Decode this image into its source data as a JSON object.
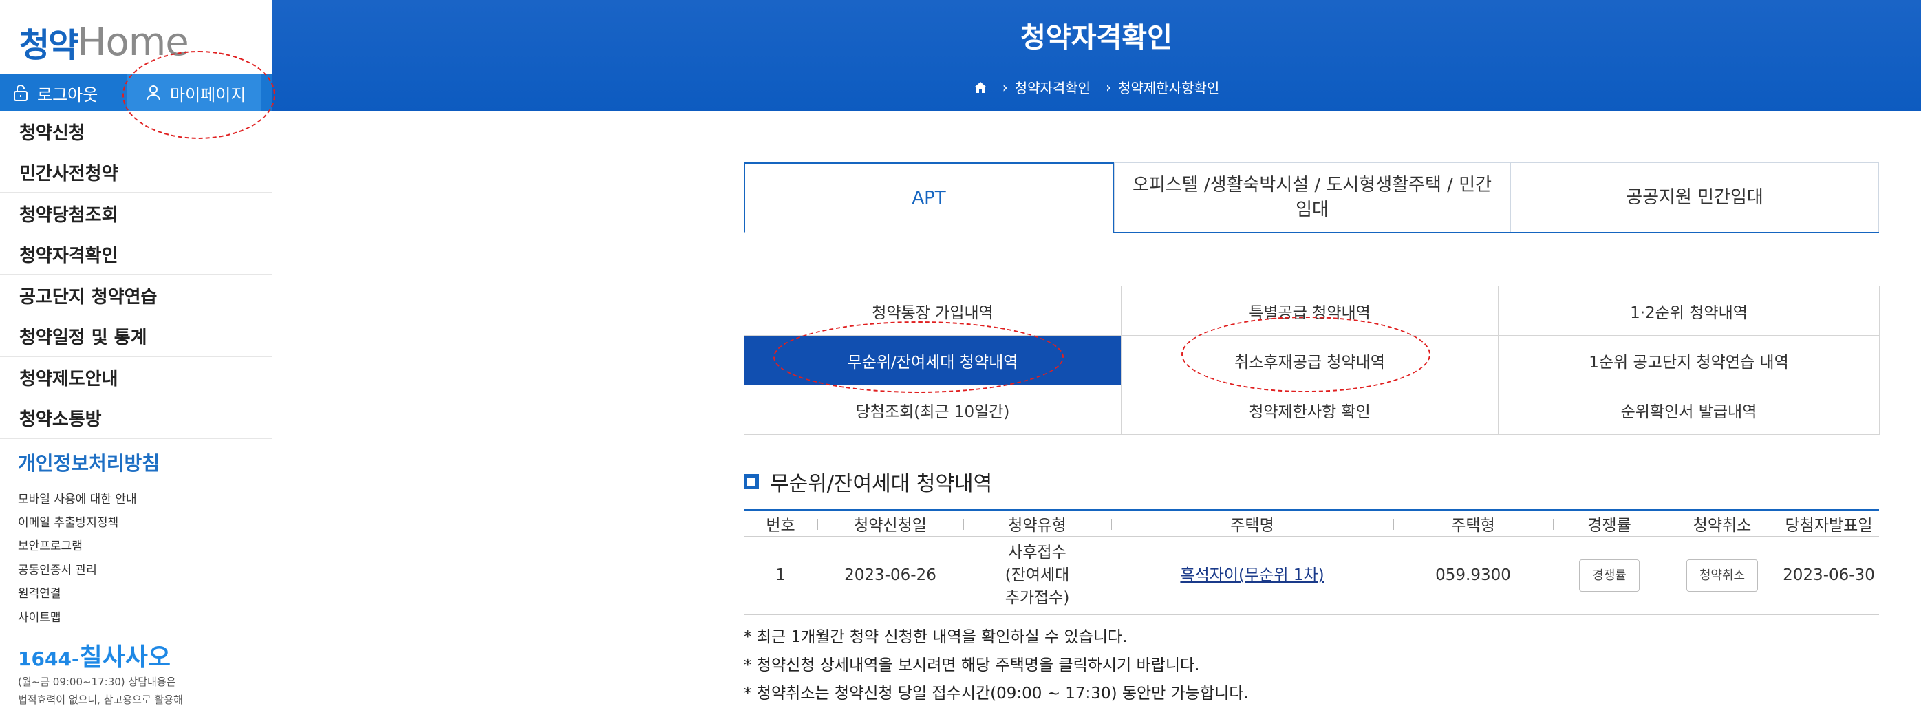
{
  "logo": {
    "text_part1": "청약",
    "text_part2": "Home"
  },
  "auth": {
    "logout_label": "로그아웃",
    "mypage_label": "마이페이지"
  },
  "sidebar": {
    "items": [
      {
        "label": "청약신청"
      },
      {
        "label": "민간사전청약"
      },
      {
        "label": "청약당첨조회"
      },
      {
        "label": "청약자격확인"
      },
      {
        "label": "공고단지 청약연습"
      },
      {
        "label": "청약일정 및 통계"
      },
      {
        "label": "청약제도안내"
      },
      {
        "label": "청약소통방"
      }
    ],
    "policy_title": "개인정보처리방침",
    "policy_links": [
      {
        "label": "모바일 사용에 대한 안내"
      },
      {
        "label": "이메일 추출방지정책"
      },
      {
        "label": "보안프로그램"
      },
      {
        "label": "공동인증서 관리"
      },
      {
        "label": "원격연결"
      },
      {
        "label": "사이트맵"
      }
    ],
    "call_prefix": "1644-",
    "call_name": "칠사사오",
    "call_note1": "(월~금 09:00~17:30) 상담내용은",
    "call_note2": "법적효력이 없으니, 참고용으로 활용해"
  },
  "header": {
    "title": "청약자격확인",
    "breadcrumb": [
      "청약자격확인",
      "청약제한사항확인"
    ]
  },
  "tabs": [
    {
      "label": "APT",
      "active": true
    },
    {
      "label": "오피스텔 /생활숙박시설 / 도시형생활주택 / 민간임대",
      "active": false
    },
    {
      "label": "공공지원 민간임대",
      "active": false
    }
  ],
  "subtabs": [
    {
      "label": "청약통장 가입내역"
    },
    {
      "label": "특별공급 청약내역"
    },
    {
      "label": "1·2순위 청약내역"
    },
    {
      "label": "무순위/잔여세대 청약내역",
      "active": true
    },
    {
      "label": "취소후재공급 청약내역"
    },
    {
      "label": "1순위 공고단지 청약연습 내역"
    },
    {
      "label": "당첨조회(최근 10일간)"
    },
    {
      "label": "청약제한사항 확인"
    },
    {
      "label": "순위확인서 발급내역"
    }
  ],
  "section": {
    "title": "무순위/잔여세대 청약내역"
  },
  "table": {
    "headers": [
      "번호",
      "청약신청일",
      "청약유형",
      "주택명",
      "주택형",
      "경쟁률",
      "청약취소",
      "당첨자발표일"
    ],
    "rows": [
      {
        "no": "1",
        "apply_date": "2023-06-26",
        "type_line1": "사후접수",
        "type_line2": "(잔여세대",
        "type_line3": "추가접수)",
        "house_name": "흑석자이(무순위 1차)",
        "house_type": "059.9300",
        "competition_button": "경쟁률",
        "cancel_button": "청약취소",
        "announce_date": "2023-06-30"
      }
    ]
  },
  "notes": [
    "* 최근 1개월간 청약 신청한 내역을 확인하실 수 있습니다.",
    "* 청약신청 상세내역을 보시려면 해당 주택명을 클릭하시기 바랍니다.",
    "* 청약취소는 청약신청 당일 접수시간(09:00 ~ 17:30) 동안만 가능합니다."
  ],
  "colors": {
    "primary": "#1565c0",
    "header_bg": "#0d5bc0",
    "active_subtab": "#114fb0",
    "annotation": "#e02020"
  }
}
